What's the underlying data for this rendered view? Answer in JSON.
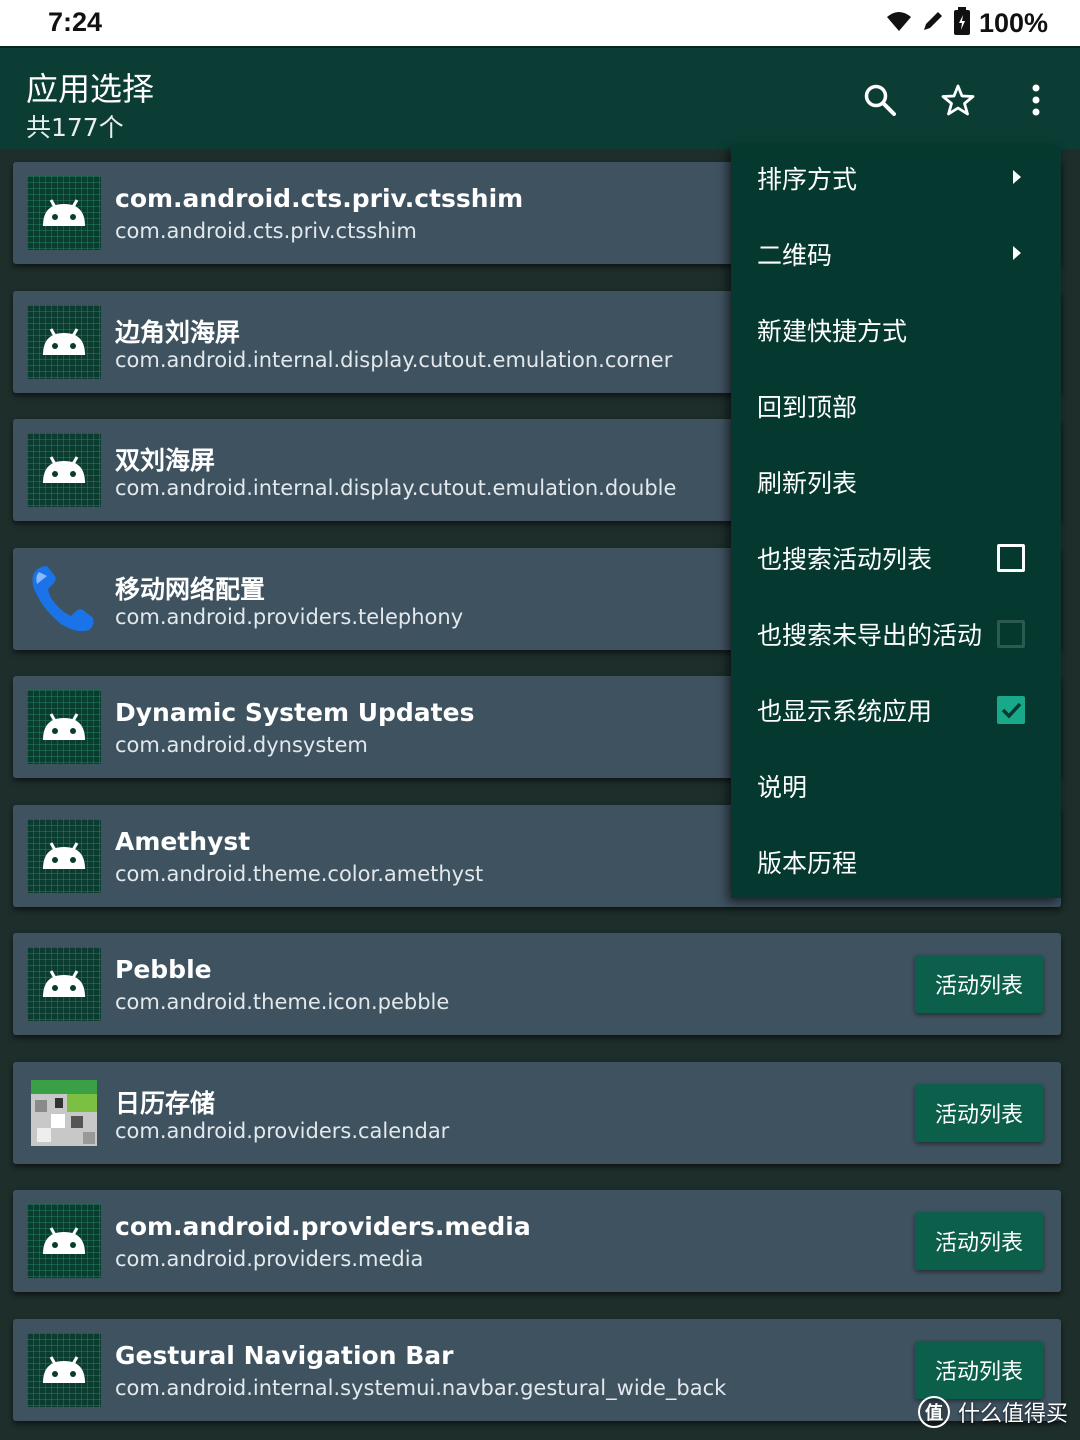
{
  "status": {
    "time": "7:24",
    "battery": "100%"
  },
  "appbar": {
    "title": "应用选择",
    "subtitle": "共177个"
  },
  "apps": [
    {
      "name": "com.android.cts.priv.ctsshim",
      "pkg": "com.android.cts.priv.ctsshim",
      "icon": "android-icon"
    },
    {
      "name": "边角刘海屏",
      "pkg": "com.android.internal.display.cutout.emulation.corner",
      "icon": "android-icon"
    },
    {
      "name": "双刘海屏",
      "pkg": "com.android.internal.display.cutout.emulation.double",
      "icon": "android-icon"
    },
    {
      "name": "移动网络配置",
      "pkg": "com.android.providers.telephony",
      "icon": "phone-icon"
    },
    {
      "name": "Dynamic System Updates",
      "pkg": "com.android.dynsystem",
      "icon": "android-icon"
    },
    {
      "name": "Amethyst",
      "pkg": "com.android.theme.color.amethyst",
      "icon": "android-icon"
    },
    {
      "name": "Pebble",
      "pkg": "com.android.theme.icon.pebble",
      "icon": "android-icon",
      "button": "活动列表"
    },
    {
      "name": "日历存储",
      "pkg": "com.android.providers.calendar",
      "icon": "calendar-icon",
      "button": "活动列表"
    },
    {
      "name": "com.android.providers.media",
      "pkg": "com.android.providers.media",
      "icon": "android-icon",
      "button": "活动列表"
    },
    {
      "name": "Gestural Navigation Bar",
      "pkg": "com.android.internal.systemui.navbar.gestural_wide_back",
      "icon": "android-icon",
      "button": "活动列表"
    }
  ],
  "menu": {
    "items": [
      {
        "label": "排序方式",
        "submenu": true
      },
      {
        "label": "二维码",
        "submenu": true
      },
      {
        "label": "新建快捷方式"
      },
      {
        "label": "回到顶部"
      },
      {
        "label": "刷新列表"
      },
      {
        "label": "也搜索活动列表",
        "checkbox": "unchecked"
      },
      {
        "label": "也搜索未导出的活动",
        "checkbox": "disabled"
      },
      {
        "label": "也显示系统应用",
        "checkbox": "checked"
      },
      {
        "label": "说明"
      },
      {
        "label": "版本历程"
      }
    ]
  },
  "watermark": {
    "badge": "值",
    "text": "什么值得买"
  },
  "colors": {
    "appbar": "#0b3d34",
    "card": "#3f5260",
    "menu": "#05392f",
    "button": "#0b5f4b",
    "check": "#1aa88a"
  }
}
